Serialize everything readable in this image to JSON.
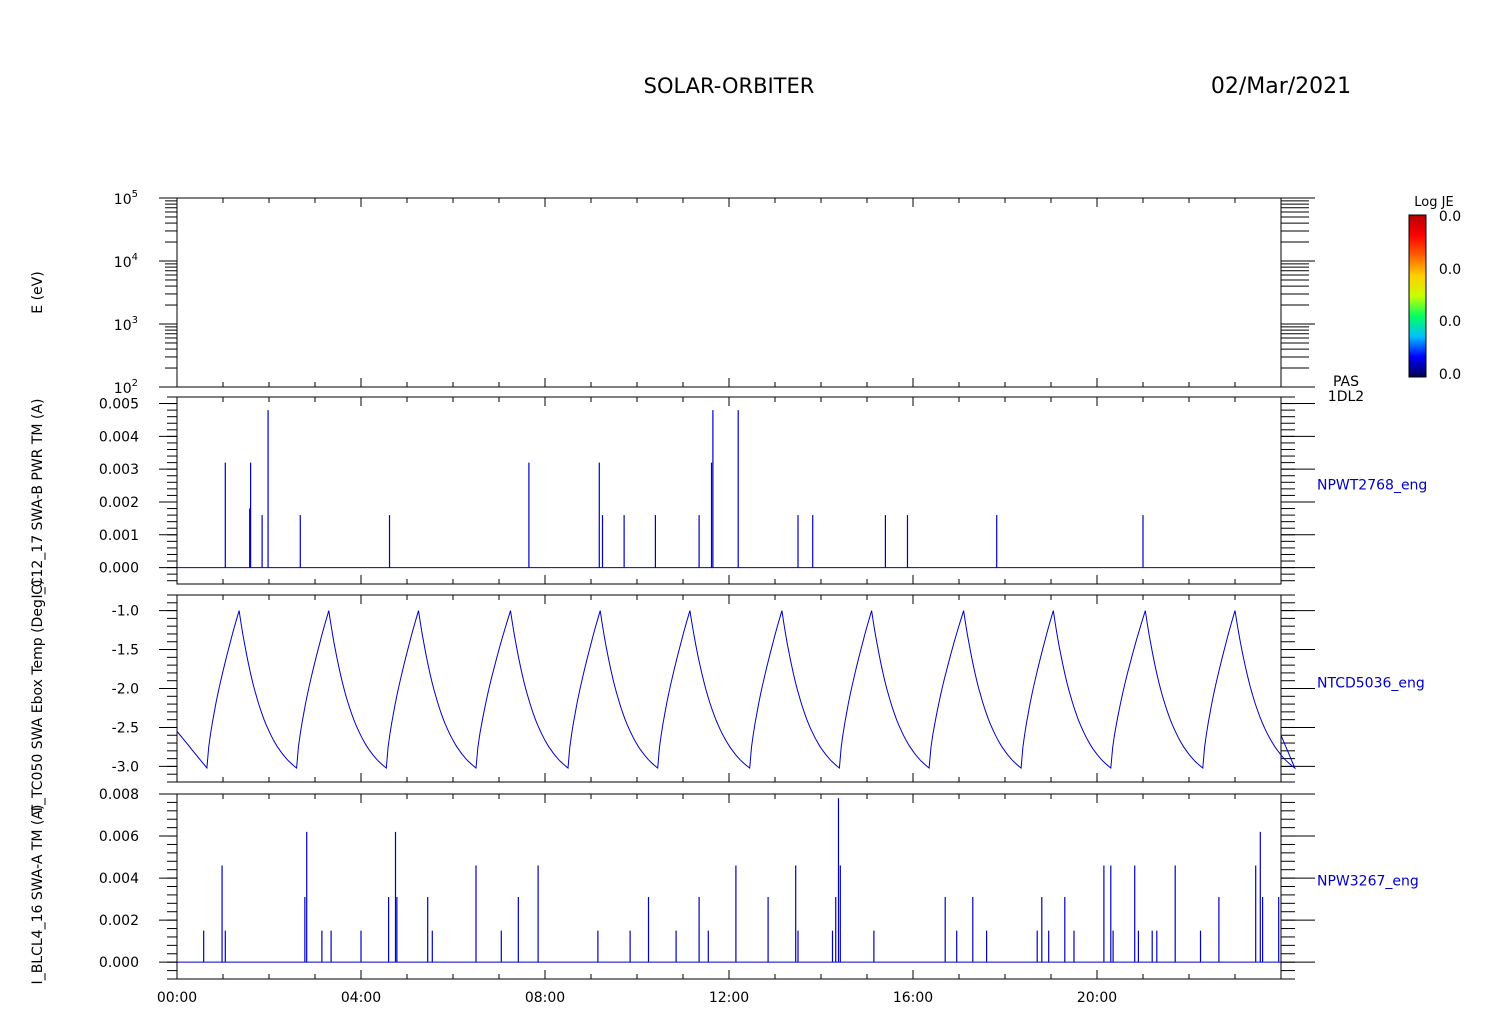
{
  "header": {
    "title": "SOLAR-ORBITER",
    "date": "02/Mar/2021"
  },
  "colorbar": {
    "title": "Log JE",
    "tick_labels": [
      "0.0",
      "0.0",
      "0.0",
      "0.0"
    ],
    "colors": [
      "#000050",
      "#0000ff",
      "#00c0ff",
      "#00ff60",
      "#c8ff00",
      "#ffd000",
      "#ff6000",
      "#ff0000",
      "#b40000"
    ]
  },
  "colors": {
    "trace": "#0000c8",
    "axes": "#000000",
    "background": "#ffffff"
  },
  "x_axis": {
    "range_hours": [
      0,
      24
    ],
    "tick_labels": [
      "00:00",
      "04:00",
      "08:00",
      "12:00",
      "16:00",
      "20:00"
    ],
    "major_tick_hours": [
      0,
      4,
      8,
      12,
      16,
      20
    ]
  },
  "chart_data": [
    {
      "type": "heatmap",
      "ylabel": "E (eV)",
      "yscale": "log",
      "ylim": [
        100,
        100000
      ],
      "ytick_labels": [
        {
          "base": "10",
          "exp": "5"
        },
        {
          "base": "10",
          "exp": "4"
        },
        {
          "base": "10",
          "exp": "3"
        },
        {
          "base": "10",
          "exp": "2"
        }
      ],
      "right_labels": [
        "PAS",
        "1DL2"
      ],
      "values": []
    },
    {
      "type": "line",
      "ylabel": "NPWT2768_eng",
      "left_label": "I_C12_17 SWA-B PWR TM (A)",
      "ylim": [
        -0.0005,
        0.0052
      ],
      "ytick_labels": [
        "0.005",
        "0.004",
        "0.003",
        "0.002",
        "0.001",
        "0.000"
      ],
      "ytick_values": [
        0.005,
        0.004,
        0.003,
        0.002,
        0.001,
        0.0
      ],
      "series": [
        {
          "spikes": [
            [
              1.05,
              0.0032
            ],
            [
              1.6,
              0.0032
            ],
            [
              1.85,
              0.0016
            ],
            [
              1.58,
              0.0018
            ],
            [
              1.98,
              0.0048
            ],
            [
              2.68,
              0.0016
            ],
            [
              4.62,
              0.0016
            ],
            [
              7.65,
              0.0032
            ],
            [
              9.18,
              0.0032
            ],
            [
              9.25,
              0.0016
            ],
            [
              9.72,
              0.0016
            ],
            [
              10.4,
              0.0016
            ],
            [
              11.35,
              0.0016
            ],
            [
              11.62,
              0.0032
            ],
            [
              11.65,
              0.0048
            ],
            [
              12.2,
              0.0048
            ],
            [
              13.5,
              0.0016
            ],
            [
              13.82,
              0.0016
            ],
            [
              15.4,
              0.0016
            ],
            [
              15.88,
              0.0016
            ],
            [
              17.82,
              0.0016
            ],
            [
              21.0,
              0.0016
            ]
          ]
        }
      ]
    },
    {
      "type": "line",
      "ylabel": "NTCD5036_eng",
      "left_label": "T_TC050 SWA Ebox Temp (Deg C)",
      "ylim": [
        -3.2,
        -0.8
      ],
      "ytick_labels": [
        "-1.0",
        "-1.5",
        "-2.0",
        "-2.5",
        "-3.0"
      ],
      "ytick_values": [
        -1.0,
        -1.5,
        -2.0,
        -2.5,
        -3.0
      ],
      "series": [
        {
          "start_value": -2.55,
          "end_value": -2.6,
          "minima_hours": [
            0.65,
            2.6,
            4.55,
            6.5,
            8.5,
            10.45,
            12.45,
            14.4,
            16.35,
            18.35,
            20.3,
            22.3
          ],
          "maxima_hours": [
            1.35,
            3.3,
            5.25,
            7.25,
            9.2,
            11.15,
            13.15,
            15.1,
            17.1,
            19.05,
            21.05,
            23.0
          ],
          "min_value": -3.02,
          "max_value": -1.0
        }
      ]
    },
    {
      "type": "line",
      "ylabel": "NPW3267_eng",
      "left_label": "I_BLCL4_16 SWA-A TM (A)",
      "ylim": [
        -0.0008,
        0.008
      ],
      "ytick_labels": [
        "0.008",
        "0.006",
        "0.004",
        "0.002",
        "0.000"
      ],
      "ytick_values": [
        0.008,
        0.006,
        0.004,
        0.002,
        0.0
      ],
      "series": [
        {
          "spikes": [
            [
              0.58,
              0.0015
            ],
            [
              0.98,
              0.0046
            ],
            [
              1.05,
              0.0015
            ],
            [
              2.78,
              0.0031
            ],
            [
              2.82,
              0.0062
            ],
            [
              3.15,
              0.0015
            ],
            [
              3.35,
              0.0015
            ],
            [
              4.0,
              0.0015
            ],
            [
              4.6,
              0.0031
            ],
            [
              4.75,
              0.0062
            ],
            [
              4.78,
              0.0031
            ],
            [
              5.45,
              0.0031
            ],
            [
              5.55,
              0.0015
            ],
            [
              6.5,
              0.0046
            ],
            [
              7.05,
              0.0015
            ],
            [
              7.42,
              0.0031
            ],
            [
              7.85,
              0.0046
            ],
            [
              9.15,
              0.0015
            ],
            [
              9.85,
              0.0015
            ],
            [
              10.25,
              0.0031
            ],
            [
              10.85,
              0.0015
            ],
            [
              11.35,
              0.0031
            ],
            [
              11.55,
              0.0015
            ],
            [
              12.15,
              0.0046
            ],
            [
              12.85,
              0.0031
            ],
            [
              13.45,
              0.0046
            ],
            [
              13.5,
              0.0015
            ],
            [
              14.25,
              0.0015
            ],
            [
              14.32,
              0.0031
            ],
            [
              14.38,
              0.0078
            ],
            [
              14.42,
              0.0046
            ],
            [
              15.15,
              0.0015
            ],
            [
              16.7,
              0.0031
            ],
            [
              16.95,
              0.0015
            ],
            [
              17.3,
              0.0031
            ],
            [
              17.6,
              0.0015
            ],
            [
              18.7,
              0.0015
            ],
            [
              18.8,
              0.0031
            ],
            [
              18.95,
              0.0015
            ],
            [
              19.3,
              0.0031
            ],
            [
              19.5,
              0.0015
            ],
            [
              20.15,
              0.0046
            ],
            [
              20.3,
              0.0046
            ],
            [
              20.35,
              0.0015
            ],
            [
              20.82,
              0.0046
            ],
            [
              20.9,
              0.0015
            ],
            [
              21.2,
              0.0015
            ],
            [
              21.3,
              0.0015
            ],
            [
              21.7,
              0.0046
            ],
            [
              22.25,
              0.0015
            ],
            [
              22.65,
              0.0031
            ],
            [
              23.45,
              0.0046
            ],
            [
              23.55,
              0.0062
            ],
            [
              23.6,
              0.0031
            ],
            [
              23.95,
              0.0031
            ]
          ]
        }
      ]
    }
  ]
}
